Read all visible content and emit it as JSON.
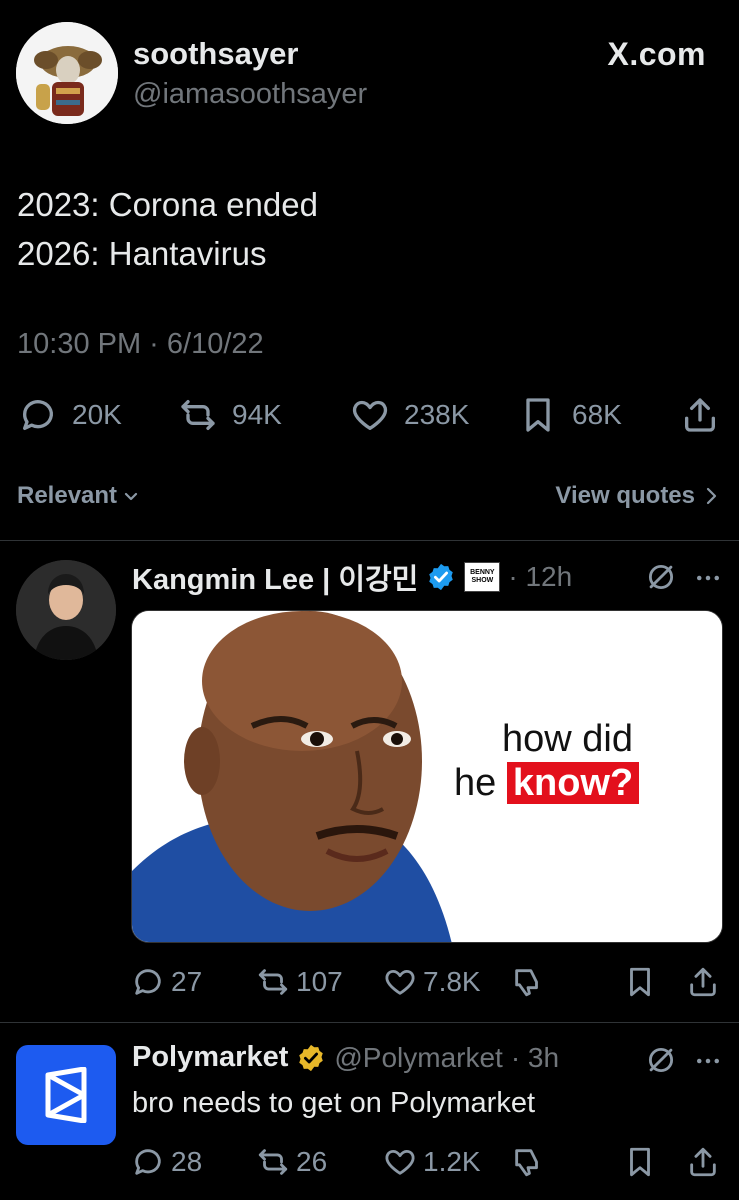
{
  "header": {
    "author_name": "soothsayer",
    "author_handle": "@iamasoothsayer",
    "watermark": "X.com"
  },
  "tweet": {
    "line1": "2023: Corona ended",
    "line2": "2026: Hantavirus",
    "time": "10:30 PM · 6/10/22",
    "stats": {
      "replies": "20K",
      "reposts": "94K",
      "likes": "238K",
      "bookmarks": "68K"
    }
  },
  "sort": {
    "label": "Relevant",
    "view_quotes": "View quotes"
  },
  "replies": [
    {
      "name": "Kangmin Lee | 이강민",
      "badge_text": "BENNY SHOW",
      "time": "· 12h",
      "media_caption_line1": "how did",
      "media_caption_he": "he",
      "media_caption_highlight": "know?",
      "stats": {
        "replies": "27",
        "reposts": "107",
        "likes": "7.8K"
      }
    },
    {
      "name": "Polymarket",
      "handle": "@Polymarket",
      "time": "· 3h",
      "text": "bro needs to get on Polymarket",
      "stats": {
        "replies": "28",
        "reposts": "26",
        "likes": "1.2K"
      }
    }
  ],
  "colors": {
    "background": "#000000",
    "text": "#e7e9ea",
    "muted": "#71767b",
    "verified_blue": "#1d9bf0",
    "verified_gold": "#e8b829",
    "polymarket_blue": "#1d5bf0"
  }
}
